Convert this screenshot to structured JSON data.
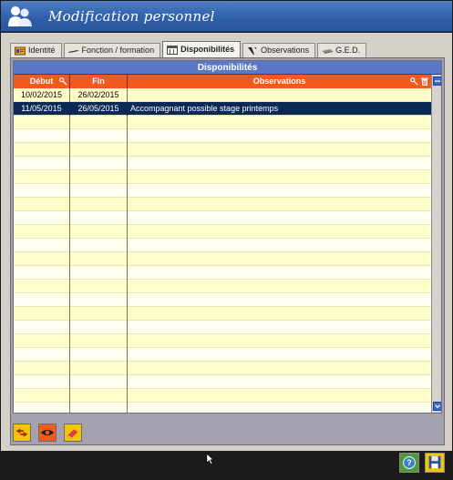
{
  "window": {
    "title": "Modification personnel"
  },
  "tabs": [
    {
      "label": "Identité",
      "icon": "id-card-icon",
      "active": false
    },
    {
      "label": "Fonction / formation",
      "icon": "pen-icon",
      "active": false
    },
    {
      "label": "Disponibilités",
      "icon": "calendar-icon",
      "active": true
    },
    {
      "label": "Observations",
      "icon": "note-icon",
      "active": false
    },
    {
      "label": "G.E.D.",
      "icon": "document-icon",
      "active": false
    }
  ],
  "grid": {
    "title": "Disponibilités",
    "columns": [
      {
        "label": "Début",
        "sortable": true
      },
      {
        "label": "Fin",
        "sortable": false
      },
      {
        "label": "Observations",
        "sortable": true
      }
    ],
    "rows": [
      {
        "debut": "10/02/2015",
        "fin": "26/02/2015",
        "observations": ""
      },
      {
        "debut": "11/05/2015",
        "fin": "26/05/2015",
        "observations": "Accompagnant possible stage printemps"
      }
    ],
    "selected_row": 1
  },
  "toolbar": [
    {
      "name": "swap-button",
      "icon": "swap-icon"
    },
    {
      "name": "view-button",
      "icon": "eye-icon"
    },
    {
      "name": "erase-button",
      "icon": "eraser-icon"
    }
  ],
  "footer": [
    {
      "name": "help-button",
      "icon": "help-icon"
    },
    {
      "name": "save-button",
      "icon": "save-icon"
    }
  ],
  "colors": {
    "title_bar": "#2f5ea8",
    "grid_header": "#f05b1c",
    "grid_title": "#5b78c7",
    "row_yellow": "#ffffcc",
    "row_alt": "#fffff0",
    "selected_row": "#0a2a55"
  }
}
